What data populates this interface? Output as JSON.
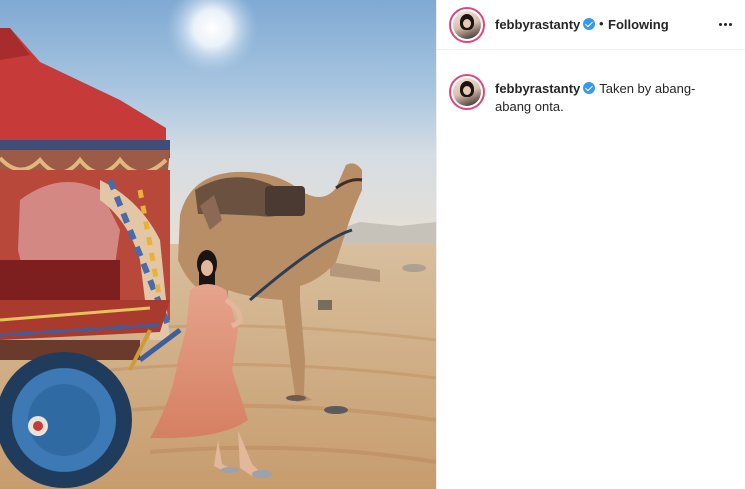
{
  "post": {
    "username": "febbyrastanty",
    "follow_status": "Following",
    "separator": "•",
    "caption": "Taken by abang-abang onta.",
    "colors": {
      "verified_badge": "#3897f0",
      "story_ring": "#e0457b",
      "text": "#262626"
    },
    "icons": {
      "verified": "verified-badge-icon",
      "more": "more-options-icon"
    }
  }
}
